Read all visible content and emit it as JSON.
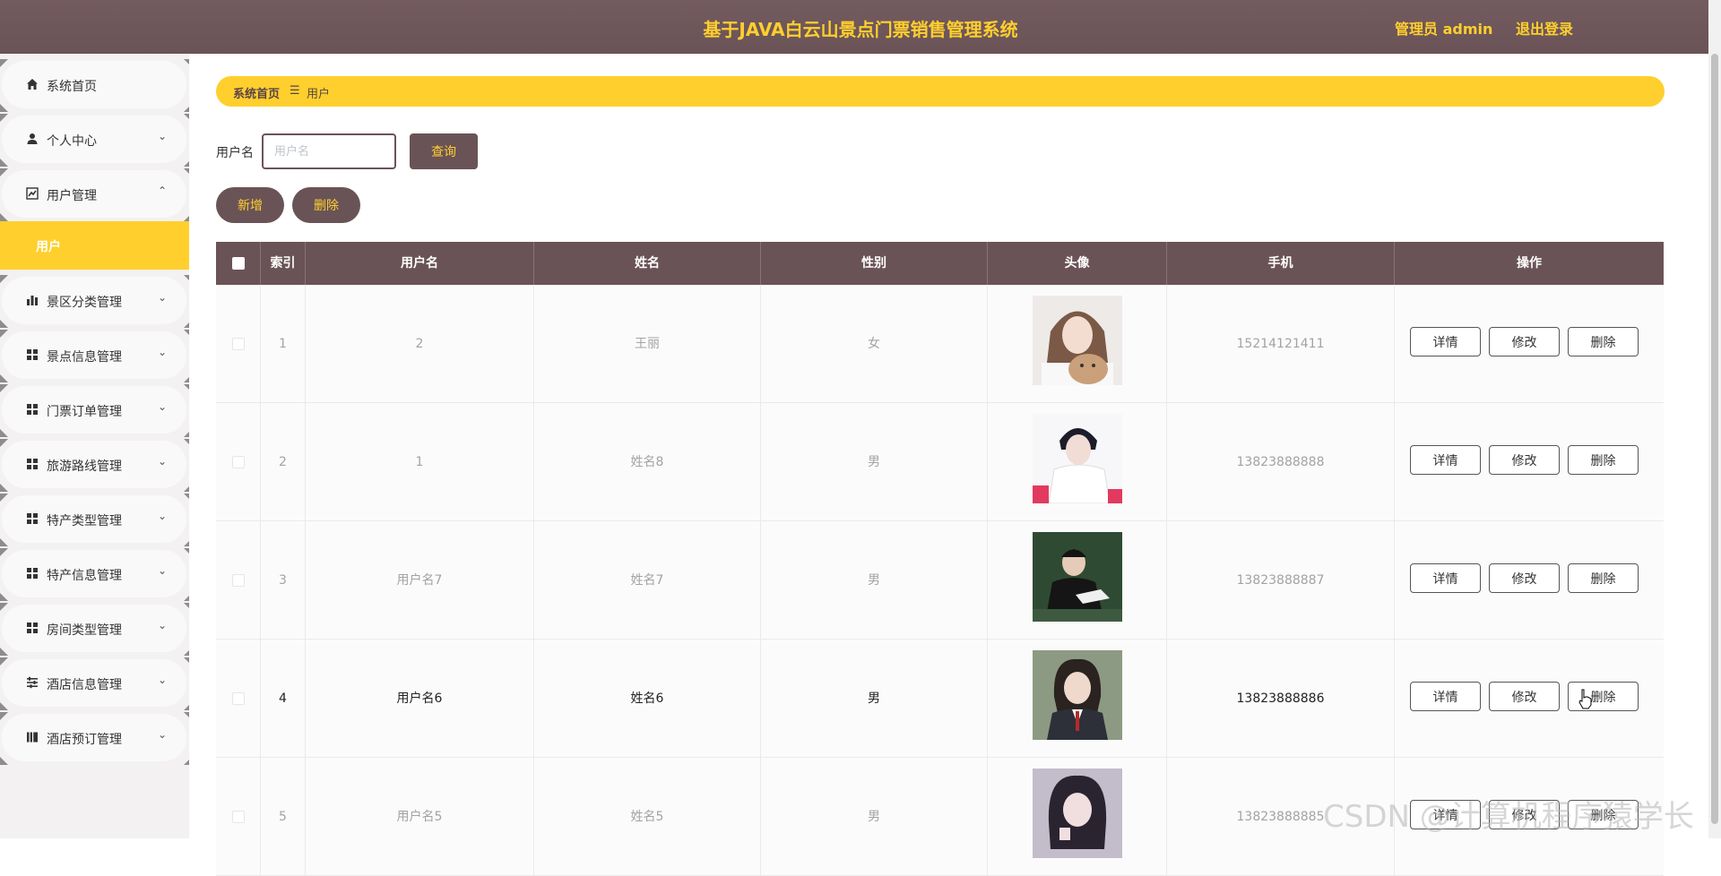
{
  "header": {
    "title": "基于JAVA白云山景点门票销售管理系统",
    "user": "管理员 admin",
    "logout": "退出登录"
  },
  "sidebar": {
    "items": [
      {
        "label": "系统首页",
        "icon": "home-icon",
        "chevron": ""
      },
      {
        "label": "个人中心",
        "icon": "person-icon",
        "chevron": "⌄"
      },
      {
        "label": "用户管理",
        "icon": "chart-line-icon",
        "chevron": "⌃"
      },
      {
        "label": "景区分类管理",
        "icon": "bar-chart-icon",
        "chevron": "⌄"
      },
      {
        "label": "景点信息管理",
        "icon": "grid-icon",
        "chevron": "⌄"
      },
      {
        "label": "门票订单管理",
        "icon": "grid-icon",
        "chevron": "⌄"
      },
      {
        "label": "旅游路线管理",
        "icon": "grid-icon",
        "chevron": "⌄"
      },
      {
        "label": "特产类型管理",
        "icon": "grid-icon",
        "chevron": "⌄"
      },
      {
        "label": "特产信息管理",
        "icon": "grid-icon",
        "chevron": "⌄"
      },
      {
        "label": "房间类型管理",
        "icon": "grid-icon",
        "chevron": "⌄"
      },
      {
        "label": "酒店信息管理",
        "icon": "sliders-icon",
        "chevron": "⌄"
      },
      {
        "label": "酒店预订管理",
        "icon": "book-icon",
        "chevron": "⌄"
      }
    ],
    "active_sub": "用户"
  },
  "breadcrumb": {
    "home": "系统首页",
    "sep": "☰",
    "current": "用户"
  },
  "search": {
    "label": "用户名",
    "placeholder": "用户名",
    "button": "查询"
  },
  "actions": {
    "add": "新增",
    "delete": "删除"
  },
  "table": {
    "headers": [
      "索引",
      "用户名",
      "姓名",
      "性别",
      "头像",
      "手机",
      "操作"
    ],
    "op_labels": {
      "detail": "详情",
      "edit": "修改",
      "delete": "删除"
    },
    "rows": [
      {
        "index": "1",
        "username": "2",
        "name": "王丽",
        "gender": "女",
        "phone": "15214121411"
      },
      {
        "index": "2",
        "username": "1",
        "name": "姓名8",
        "gender": "男",
        "phone": "13823888888"
      },
      {
        "index": "3",
        "username": "用户名7",
        "name": "姓名7",
        "gender": "男",
        "phone": "13823888887"
      },
      {
        "index": "4",
        "username": "用户名6",
        "name": "姓名6",
        "gender": "男",
        "phone": "13823888886"
      },
      {
        "index": "5",
        "username": "用户名5",
        "name": "姓名5",
        "gender": "男",
        "phone": "13823888885"
      }
    ]
  },
  "watermark": "CSDN @计算机程序猿学长",
  "colors": {
    "primary": "#6a5357",
    "accent": "#ffcf2d"
  }
}
